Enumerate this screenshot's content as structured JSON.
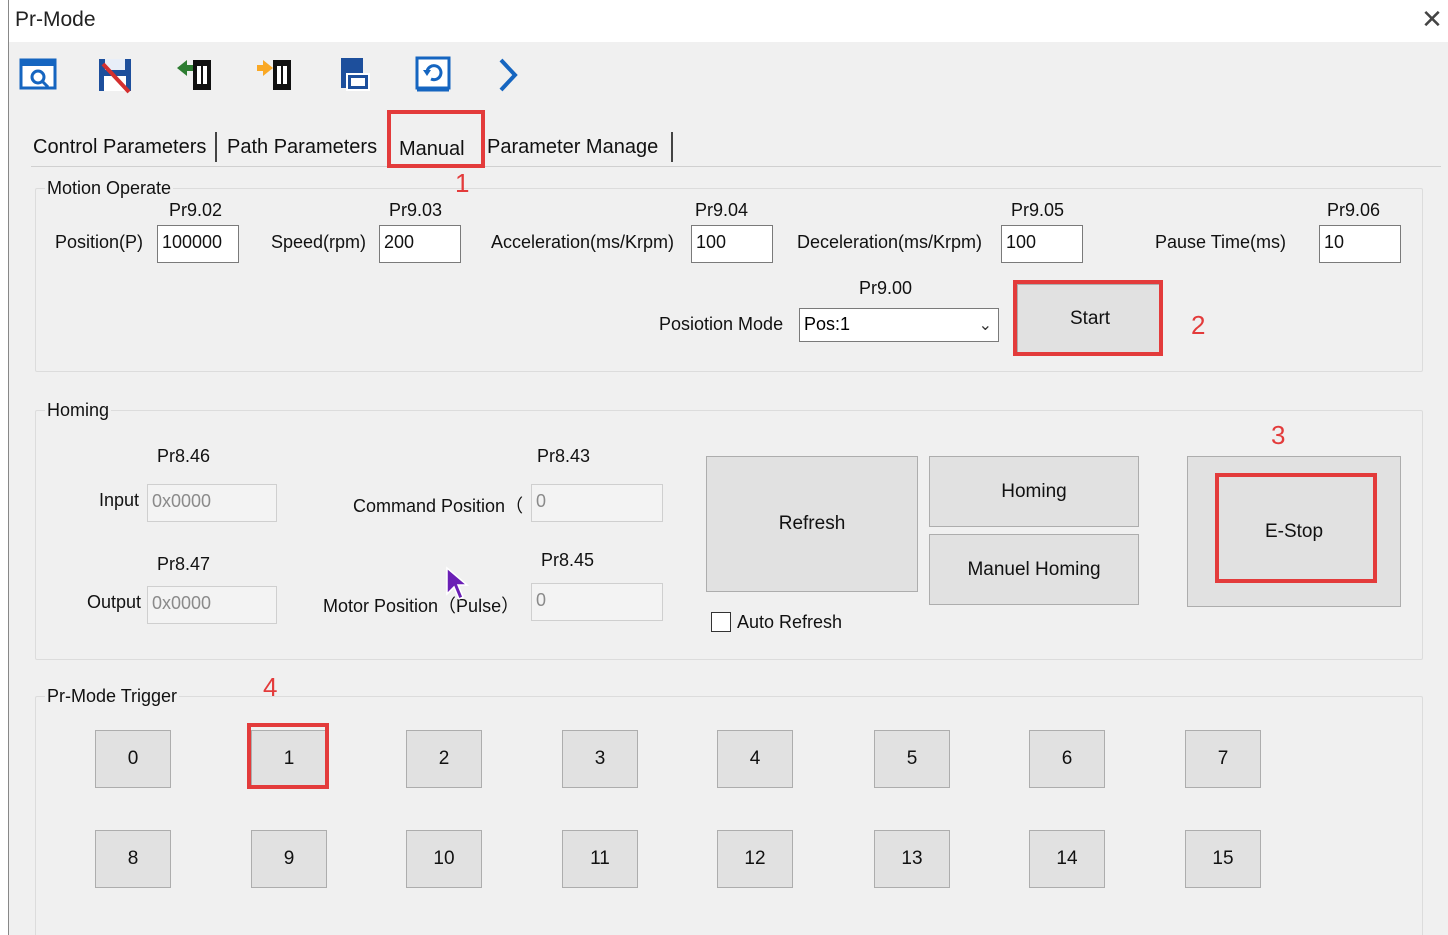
{
  "window": {
    "title": "Pr-Mode",
    "close_glyph": "✕"
  },
  "toolbar": {
    "icons": [
      "preview-icon",
      "save-icon",
      "upload-icon",
      "download-icon",
      "export-icon",
      "restore-icon",
      "next-icon"
    ]
  },
  "tabs": [
    {
      "label": "Control Parameters"
    },
    {
      "label": "Path Parameters"
    },
    {
      "label": "Manual",
      "active": true
    },
    {
      "label": "Parameter Manage"
    }
  ],
  "motion": {
    "title": "Motion Operate",
    "position": {
      "param": "Pr9.02",
      "label": "Position(P)",
      "value": "100000"
    },
    "speed": {
      "param": "Pr9.03",
      "label": "Speed(rpm)",
      "value": "200"
    },
    "accel": {
      "param": "Pr9.04",
      "label": "Acceleration(ms/Krpm)",
      "value": "100"
    },
    "decel": {
      "param": "Pr9.05",
      "label": "Deceleration(ms/Krpm)",
      "value": "100"
    },
    "pause": {
      "param": "Pr9.06",
      "label": "Pause Time(ms)",
      "value": "10"
    },
    "mode": {
      "param": "Pr9.00",
      "label": "Posiotion Mode",
      "value": "Pos:1"
    },
    "start_label": "Start"
  },
  "homing": {
    "title": "Homing",
    "input": {
      "param": "Pr8.46",
      "label": "Input",
      "value": "0x0000"
    },
    "output": {
      "param": "Pr8.47",
      "label": "Output",
      "value": "0x0000"
    },
    "command": {
      "param": "Pr8.43",
      "label": "Command Position（",
      "value": "0"
    },
    "motor": {
      "param": "Pr8.45",
      "label": "Motor Position（Pulse）",
      "value": "0"
    },
    "refresh_label": "Refresh",
    "homing_label": "Homing",
    "manual_homing_label": "Manuel Homing",
    "estop_label": "E-Stop",
    "auto_refresh_label": "Auto Refresh"
  },
  "trigger": {
    "title": "Pr-Mode Trigger",
    "buttons": [
      "0",
      "1",
      "2",
      "3",
      "4",
      "5",
      "6",
      "7",
      "8",
      "9",
      "10",
      "11",
      "12",
      "13",
      "14",
      "15"
    ]
  },
  "annotations": {
    "color": "#e33b3b",
    "n1": "1",
    "n2": "2",
    "n3": "3",
    "n4": "4"
  }
}
